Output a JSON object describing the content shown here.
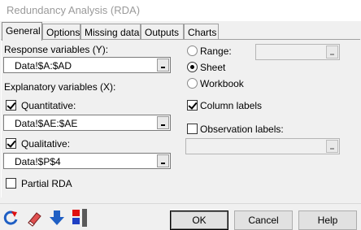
{
  "window": {
    "title": "Redundancy Analysis (RDA)"
  },
  "tabs": [
    {
      "label": "General"
    },
    {
      "label": "Options"
    },
    {
      "label": "Missing data"
    },
    {
      "label": "Outputs"
    },
    {
      "label": "Charts"
    }
  ],
  "left": {
    "response_label": "Response variables (Y):",
    "response_value": "Data!$A:$AD",
    "explanatory_label": "Explanatory variables (X):",
    "quantitative": {
      "label": "Quantitative:",
      "checked": true,
      "value": "Data!$AE:$AE"
    },
    "qualitative": {
      "label": "Qualitative:",
      "checked": true,
      "value": "Data!$P$4"
    },
    "partial_rda": {
      "label": "Partial RDA",
      "checked": false
    }
  },
  "right": {
    "range": {
      "label": "Range:",
      "selected": false,
      "value": ""
    },
    "sheet": {
      "label": "Sheet",
      "selected": true
    },
    "workbook": {
      "label": "Workbook",
      "selected": false
    },
    "column_labels": {
      "label": "Column labels",
      "checked": true
    },
    "observation_labels": {
      "label": "Observation labels:",
      "checked": false,
      "value": ""
    }
  },
  "footer": {
    "ok_label": "OK",
    "cancel_label": "Cancel",
    "help_label": "Help",
    "icons": [
      "reset-icon",
      "eraser-icon",
      "down-arrow-icon",
      "flags-icon"
    ]
  },
  "colors": {
    "accent_blue": "#1f5fc4",
    "flag_red": "#e01010"
  }
}
